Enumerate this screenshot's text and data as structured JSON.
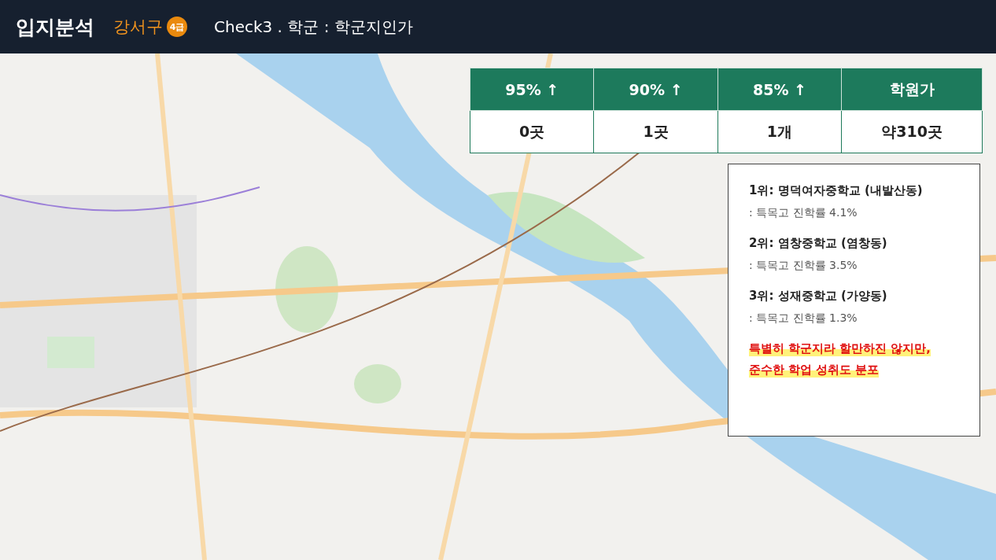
{
  "header": {
    "title": "입지분석",
    "district": "강서구",
    "grade_badge": "4급",
    "subtitle": "Check3 . 학군 : 학군지인가"
  },
  "stats_table": {
    "columns": [
      "95% ↑",
      "90% ↑",
      "85% ↑",
      "학원가"
    ],
    "values": [
      "0곳",
      "1곳",
      "1개",
      "약310곳"
    ]
  },
  "ranking_panel": {
    "items": [
      {
        "title": "1위: 명덕여자중학교 (내발산동)",
        "detail": ": 특목고 진학률 4.1%"
      },
      {
        "title": "2위: 염창중학교 (염창동)",
        "detail": ": 특목고 진학률 3.5%"
      },
      {
        "title": "3위: 성재중학교 (가양동)",
        "detail": ": 특목고 진학률 1.3%"
      }
    ],
    "note_lines": [
      "특별히 학군지라 할만하진 않지만,",
      "준수한 학업 성취도 분포"
    ]
  }
}
